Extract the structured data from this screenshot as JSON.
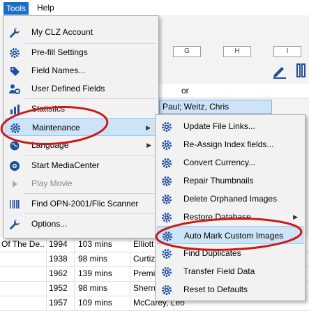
{
  "menubar": {
    "tools_label": "Tools",
    "help_label": "Help"
  },
  "background": {
    "alpha_keys": [
      "G",
      "H",
      "I"
    ],
    "column_header": "or",
    "selected_row_text": "Paul; Weitz, Chris",
    "rows": [
      {
        "title": "Of The De...",
        "year": "1994",
        "runtime": "103 mins",
        "director": "Elliott"
      },
      {
        "title": "",
        "year": "1938",
        "runtime": "98 mins",
        "director": "Curtiz"
      },
      {
        "title": "",
        "year": "1962",
        "runtime": "139 mins",
        "director": "Premi"
      },
      {
        "title": "",
        "year": "1952",
        "runtime": "98 mins",
        "director": "Shern"
      },
      {
        "title": "",
        "year": "1957",
        "runtime": "109 mins",
        "director": "McCarey, Leo"
      }
    ]
  },
  "tools_menu": {
    "items": [
      {
        "label": "My CLZ Account",
        "icon": "wrench-icon"
      },
      {
        "label": "Pre-fill Settings",
        "icon": "gear-icon"
      },
      {
        "label": "Field Names...",
        "icon": "tag-icon"
      },
      {
        "label": "User Defined Fields",
        "icon": "user-gear-icon"
      },
      {
        "label": "Statistics",
        "icon": "bar-chart-icon"
      },
      {
        "label": "Maintenance",
        "icon": "gear-icon"
      },
      {
        "label": "Language",
        "icon": "globe-icon"
      },
      {
        "label": "Start MediaCenter",
        "icon": "media-center-icon"
      },
      {
        "label": "Play Movie",
        "icon": "play-icon"
      },
      {
        "label": "Find OPN-2001/Flic Scanner",
        "icon": "barcode-icon"
      },
      {
        "label": "Options...",
        "icon": "wrench-icon"
      }
    ]
  },
  "maintenance_menu": {
    "items": [
      {
        "label": "Update File Links..."
      },
      {
        "label": "Re-Assign Index fields..."
      },
      {
        "label": "Convert Currency..."
      },
      {
        "label": "Repair Thumbnails"
      },
      {
        "label": "Delete Orphaned Images"
      },
      {
        "label": "Restore Database"
      },
      {
        "label": "Auto Mark Custom Images"
      },
      {
        "label": "Find Duplicates"
      },
      {
        "label": "Transfer Field Data"
      },
      {
        "label": "Reset to Defaults"
      }
    ]
  },
  "colors": {
    "highlight": "#cde4f7",
    "menu_bg": "#f2f2f2",
    "annotation_red": "#cc1a1a",
    "selection_blue": "#1a6fc9"
  }
}
